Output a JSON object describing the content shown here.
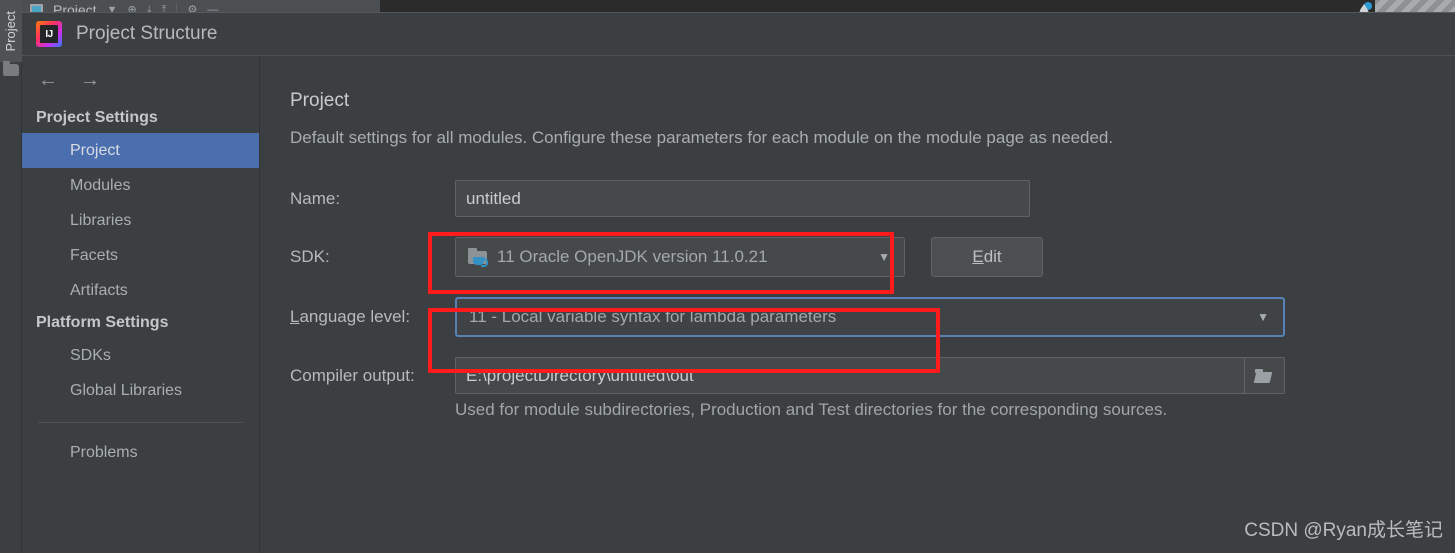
{
  "ide_toolbar": {
    "project_label": "Project",
    "icons": [
      {
        "name": "project-view-square-icon",
        "glyph": ""
      },
      {
        "name": "chevron-down-icon",
        "glyph": "▼"
      },
      {
        "name": "locate-icon",
        "glyph": "⊕"
      },
      {
        "name": "collapse-all-icon",
        "glyph": "⤓"
      },
      {
        "name": "expand-all-icon",
        "glyph": "⤒"
      },
      {
        "name": "settings-gear-icon",
        "glyph": "⚙"
      },
      {
        "name": "hide-icon",
        "glyph": "—"
      }
    ]
  },
  "left_rail": {
    "tab_label": "Project"
  },
  "dialog": {
    "title": "Project Structure",
    "logo_name": "intellij-idea-logo",
    "nav": {
      "back_label": "←",
      "forward_label": "→"
    }
  },
  "sidebar": {
    "groups": [
      {
        "name": "project-settings",
        "title": "Project Settings",
        "items": [
          {
            "id": "project",
            "label": "Project",
            "selected": true
          },
          {
            "id": "modules",
            "label": "Modules",
            "selected": false
          },
          {
            "id": "libraries",
            "label": "Libraries",
            "selected": false
          },
          {
            "id": "facets",
            "label": "Facets",
            "selected": false
          },
          {
            "id": "artifacts",
            "label": "Artifacts",
            "selected": false
          }
        ]
      },
      {
        "name": "platform-settings",
        "title": "Platform Settings",
        "items": [
          {
            "id": "sdks",
            "label": "SDKs",
            "selected": false
          },
          {
            "id": "global-libraries",
            "label": "Global Libraries",
            "selected": false
          }
        ]
      }
    ],
    "problems_label": "Problems"
  },
  "main": {
    "title": "Project",
    "description": "Default settings for all modules. Configure these parameters for each module on the module page as needed.",
    "name_field": {
      "label": "Name:",
      "value": "untitled",
      "placeholder": "untitled"
    },
    "sdk_field": {
      "label": "SDK:",
      "value": "11 Oracle OpenJDK version 11.0.21",
      "icon": "java-sdk-folder-icon",
      "caret": "▼",
      "edit_button": {
        "label": "Edit",
        "mnemonic": "E",
        "rest": "dit"
      }
    },
    "language_level_field": {
      "label": "Language level:",
      "mnemonic": "L",
      "label_rest": "anguage level:",
      "value": "11 - Local variable syntax for lambda parameters",
      "caret": "▼",
      "focused": true
    },
    "compiler_output_field": {
      "label": "Compiler output:",
      "value": "E:\\projectDirectory\\untitled\\out",
      "browse_icon": "open-folder-icon",
      "hint": "Used for module subdirectories, Production and Test directories for the corresponding sources."
    }
  },
  "annotations": {
    "color": "#fd1c1c",
    "boxes": [
      {
        "name": "sdk-highlight-box"
      },
      {
        "name": "language-level-highlight-box"
      }
    ]
  },
  "watermark": {
    "text": "CSDN @Ryan成长笔记"
  },
  "colors": {
    "background": "#3c3f41",
    "selection_blue": "#4b6eaf",
    "focus_blue": "#5781b6",
    "annotation_red": "#fd1c1c",
    "field_background": "#45494a"
  }
}
